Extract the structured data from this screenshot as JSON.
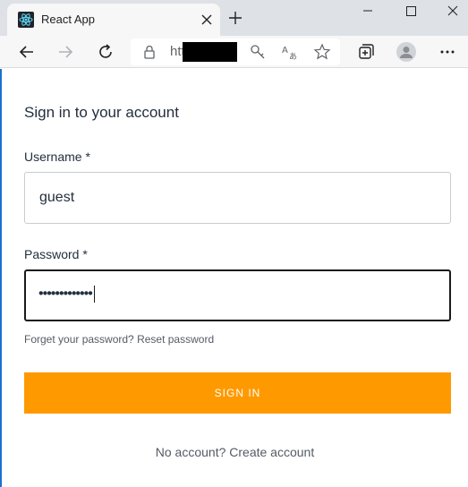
{
  "browser": {
    "tab_title": "React App",
    "url_visible": "htt",
    "icons": [
      "react-logo-icon",
      "close-icon",
      "plus-icon",
      "minimize-icon",
      "maximize-icon",
      "close-window-icon",
      "back-arrow-icon",
      "forward-arrow-icon",
      "reload-icon",
      "lock-icon",
      "key-icon",
      "translate-icon",
      "star-icon",
      "collections-icon",
      "profile-avatar-icon",
      "more-icon"
    ]
  },
  "form": {
    "title": "Sign in to your account",
    "username_label": "Username *",
    "username_value": "guest",
    "password_label": "Password *",
    "password_masked": "•••••••••••••",
    "forgot_text": "Forget your password?",
    "reset_link": "Reset password",
    "signin_label": "SIGN IN",
    "no_account_text": "No account?",
    "create_link": "Create account"
  },
  "colors": {
    "accent": "#ff9900",
    "text": "#232f3e",
    "muted": "#545b64",
    "chrome_bg": "#dee1e6",
    "react_blue": "#61dafb"
  }
}
